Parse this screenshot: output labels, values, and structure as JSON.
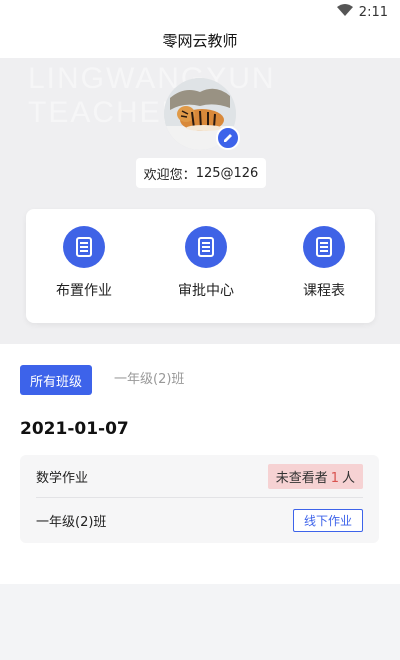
{
  "status_bar": {
    "time": "2:11",
    "wifi_icon": "wifi-icon"
  },
  "app": {
    "title": "零网云教师"
  },
  "hero": {
    "watermark": "LINGWANGYUN TEACHER",
    "avatar_icon": "tiger-avatar",
    "edit_icon": "pencil-icon",
    "welcome_prefix": "欢迎您：",
    "username": "125@126"
  },
  "menu": {
    "items": [
      {
        "label": "布置作业",
        "icon": "document-icon"
      },
      {
        "label": "审批中心",
        "icon": "document-icon"
      },
      {
        "label": "课程表",
        "icon": "document-icon"
      }
    ]
  },
  "tabs": {
    "active": "所有班级",
    "inactive": "一年级(2)班"
  },
  "homework": {
    "date": "2021-01-07",
    "title": "数学作业",
    "unchecked_prefix": "未查看者",
    "unchecked_count": "1",
    "unchecked_suffix": "人",
    "class_name": "一年级(2)班",
    "action": "线下作业"
  },
  "colors": {
    "accent": "#3d63ea",
    "badge_bg": "#f6d2d3",
    "badge_count": "#d9534f"
  }
}
